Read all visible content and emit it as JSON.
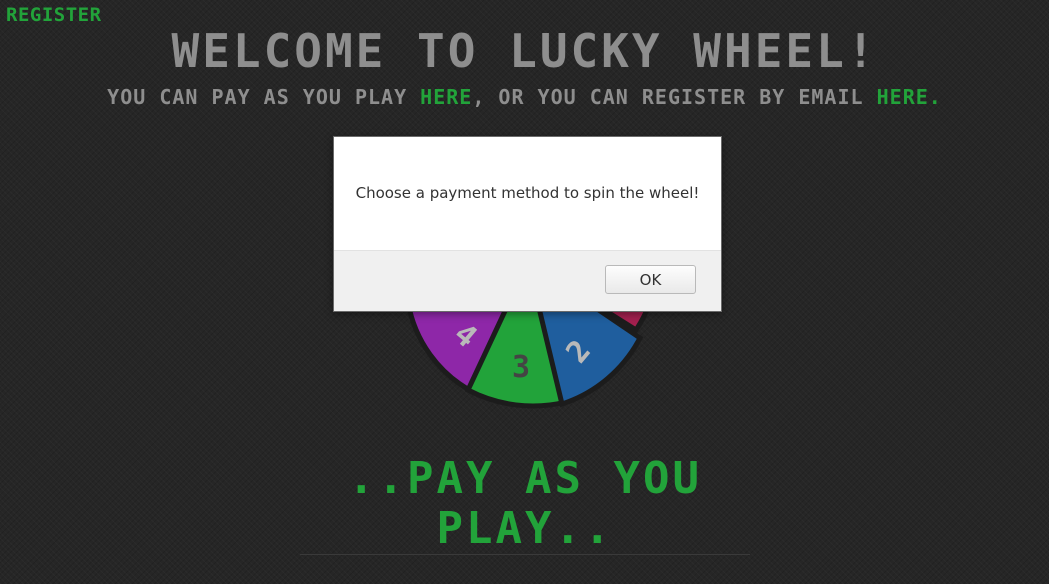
{
  "header": {
    "register_label": "REGiSTER",
    "title": "WELCOME TO LUCKY WHEEL!",
    "subtitle_part1": "YOU CAN PAY AS YOU PLAY ",
    "subtitle_link1": "HERE",
    "subtitle_part2": ", OR YOU CAN REGiSTER BY EMAiL ",
    "subtitle_link2": "HERE."
  },
  "wheel": {
    "segments": [
      {
        "name": "purple",
        "color": "#8e27a8",
        "label": "4"
      },
      {
        "name": "green",
        "color": "#22a33a",
        "label": "3"
      },
      {
        "name": "blue",
        "color": "#1f5e9e",
        "label": "2"
      },
      {
        "name": "teal",
        "color": "#1a9680",
        "label": ""
      },
      {
        "name": "crimson",
        "color": "#a3204f",
        "label": ""
      }
    ]
  },
  "pay_button_label": "..PAY AS YOU PLAY..",
  "dialog": {
    "message": "Choose a payment method to spin the wheel!",
    "ok_label": "OK"
  },
  "colors": {
    "accent": "#22a33a",
    "text": "#8e8e8e",
    "background": "#262626"
  }
}
